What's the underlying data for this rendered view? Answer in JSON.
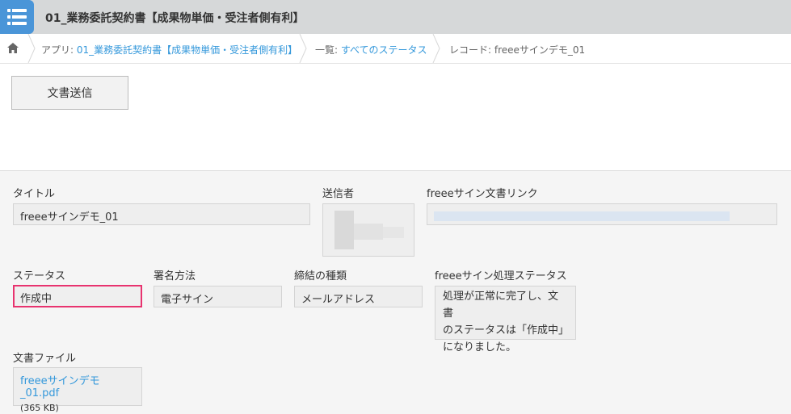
{
  "header": {
    "app_icon": "list-icon",
    "title": "01_業務委託契約書【成果物単価・受注者側有利】"
  },
  "breadcrumb": {
    "home_icon": "home-icon",
    "app_prefix": "アプリ: ",
    "app_name": "01_業務委託契約書【成果物単価・受注者側有利】",
    "view_prefix": "一覧: ",
    "view_name": "すべてのステータス",
    "record_label": "レコード: freeeサインデモ_01"
  },
  "toolbar": {
    "send_document_label": "文書送信"
  },
  "record": {
    "title": {
      "label": "タイトル",
      "value": "freeeサインデモ_01"
    },
    "sender": {
      "label": "送信者"
    },
    "document_link": {
      "label": "freeeサイン文書リンク"
    },
    "status": {
      "label": "ステータス",
      "value": "作成中"
    },
    "signing_method": {
      "label": "署名方法",
      "value": "電子サイン"
    },
    "contract_type": {
      "label": "締結の種類",
      "value": "メールアドレス"
    },
    "processing_status": {
      "label": "freeeサイン処理ステータス",
      "lines": [
        "処理が正常に完了し、文書",
        "のステータスは「作成中」",
        "になりました。"
      ]
    },
    "document_file": {
      "label": "文書ファイル",
      "file_name": "freeeサインデモ_01.pdf",
      "file_size": "(365 KB)"
    }
  },
  "colors": {
    "accent": "#3498db",
    "status_highlight": "#e8336f",
    "app_icon_bg": "#4a95d8"
  }
}
